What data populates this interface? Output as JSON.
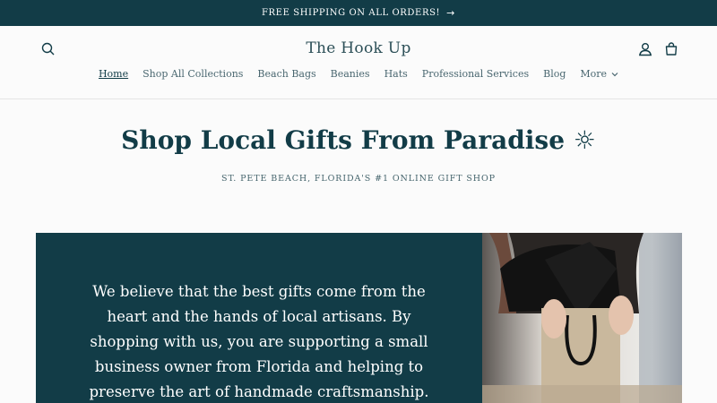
{
  "announcement": {
    "text": "FREE SHIPPING ON ALL ORDERS!",
    "arrow": "→"
  },
  "header": {
    "store_name": "The Hook Up",
    "icons": {
      "search": "search-icon",
      "account": "account-icon",
      "cart": "cart-icon"
    }
  },
  "nav": {
    "items": [
      {
        "label": "Home",
        "active": true
      },
      {
        "label": "Shop All Collections"
      },
      {
        "label": "Beach Bags"
      },
      {
        "label": "Beanies"
      },
      {
        "label": "Hats"
      },
      {
        "label": "Professional Services"
      },
      {
        "label": "Blog"
      }
    ],
    "more_label": "More"
  },
  "hero": {
    "title": "Shop Local Gifts From Paradise ☼",
    "subtitle": "ST. PETE BEACH, FLORIDA'S #1 ONLINE GIFT SHOP"
  },
  "feature": {
    "text": "We believe that the best gifts come from the heart and the hands of local artisans. By shopping with us, you are supporting a small business owner from Florida and helping to preserve the art of handmade craftsmanship."
  },
  "colors": {
    "primary": "#123c47",
    "background": "#fbfbfb",
    "text_on_primary": "#ffffff"
  }
}
